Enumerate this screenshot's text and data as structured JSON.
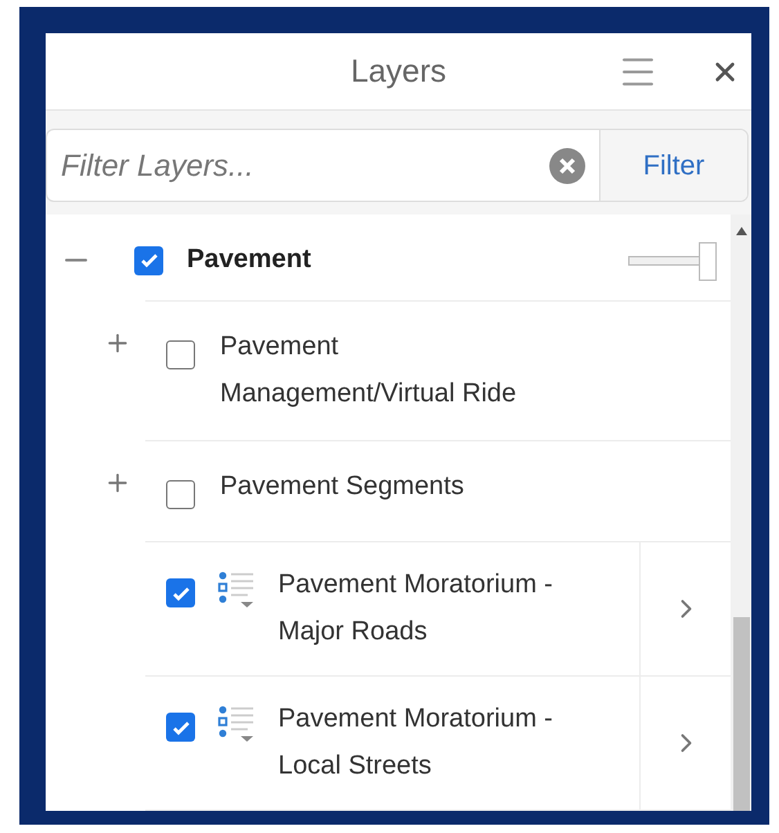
{
  "panel": {
    "title": "Layers"
  },
  "filter": {
    "placeholder": "Filter Layers...",
    "button": "Filter"
  },
  "layers": [
    {
      "name": "Pavement",
      "expanded": true,
      "checked": true,
      "level": 1,
      "children": [
        {
          "kind": "group",
          "name": "Pavement Management/Virtual Ride",
          "expanded": false,
          "checked": false
        },
        {
          "kind": "group",
          "name": "Pavement Segments",
          "expanded": false,
          "checked": false
        },
        {
          "kind": "layer",
          "name": "Pavement Moratorium - Major Roads",
          "checked": true
        },
        {
          "kind": "layer",
          "name": "Pavement Moratorium - Local Streets",
          "checked": true
        }
      ]
    }
  ]
}
